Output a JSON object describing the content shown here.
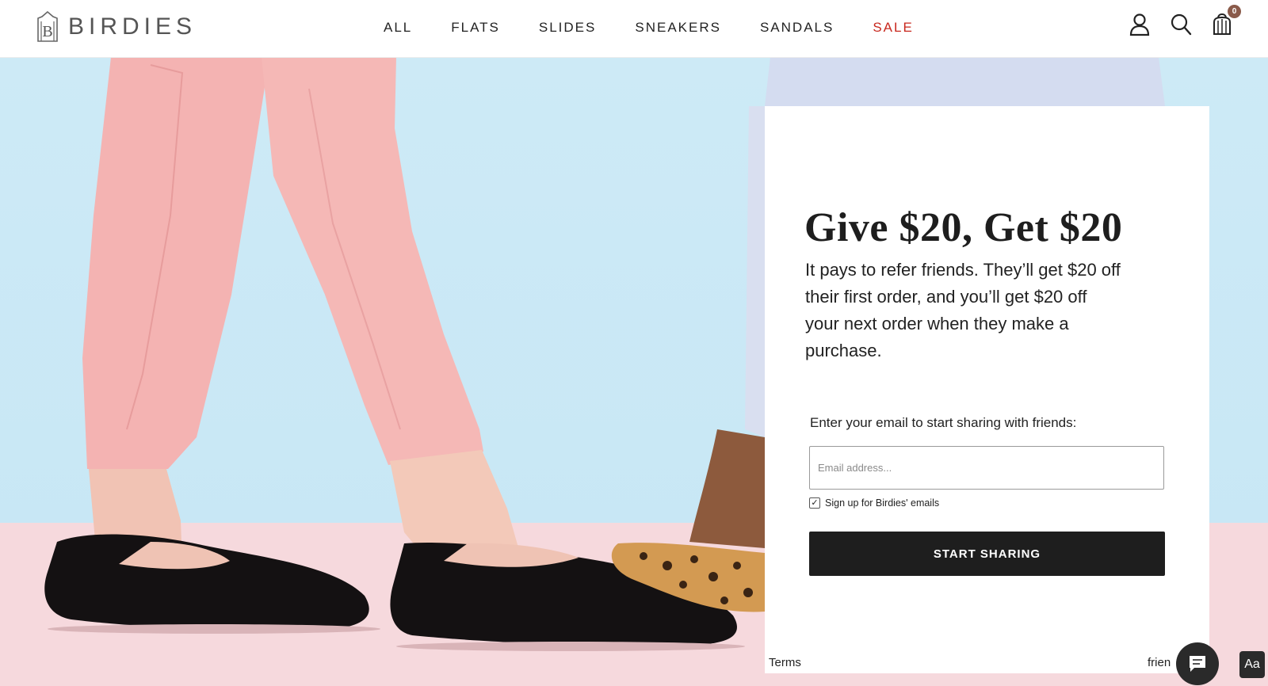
{
  "header": {
    "logo_text": "BIRDIES",
    "nav": [
      {
        "label": "ALL"
      },
      {
        "label": "FLATS"
      },
      {
        "label": "SLIDES"
      },
      {
        "label": "SNEAKERS"
      },
      {
        "label": "SANDALS"
      },
      {
        "label": "SALE"
      }
    ],
    "icons": [
      "account-icon",
      "search-icon",
      "cart-icon"
    ],
    "cart_count": "0"
  },
  "colors": {
    "sale": "#c8281e",
    "button": "#1e1e1e",
    "sky": "#cdeaf6",
    "pants": "#f4b4b4"
  },
  "referral": {
    "title": "Give $20, Get $20",
    "body": "It pays to refer friends. They’ll get $20 off their first order, and you’ll get $20 off your next order when they make a purchase.",
    "prompt": "Enter your email to start sharing with friends:",
    "email_placeholder": "Email address...",
    "email_value": "",
    "signup_label": "Sign up for Birdies' emails",
    "signup_checked": true,
    "button_label": "START SHARING",
    "terms_label": "Terms",
    "friend_label": "frien"
  },
  "widgets": {
    "chat_icon": "chat-bubble-icon",
    "accessibility_label": "Aa"
  }
}
